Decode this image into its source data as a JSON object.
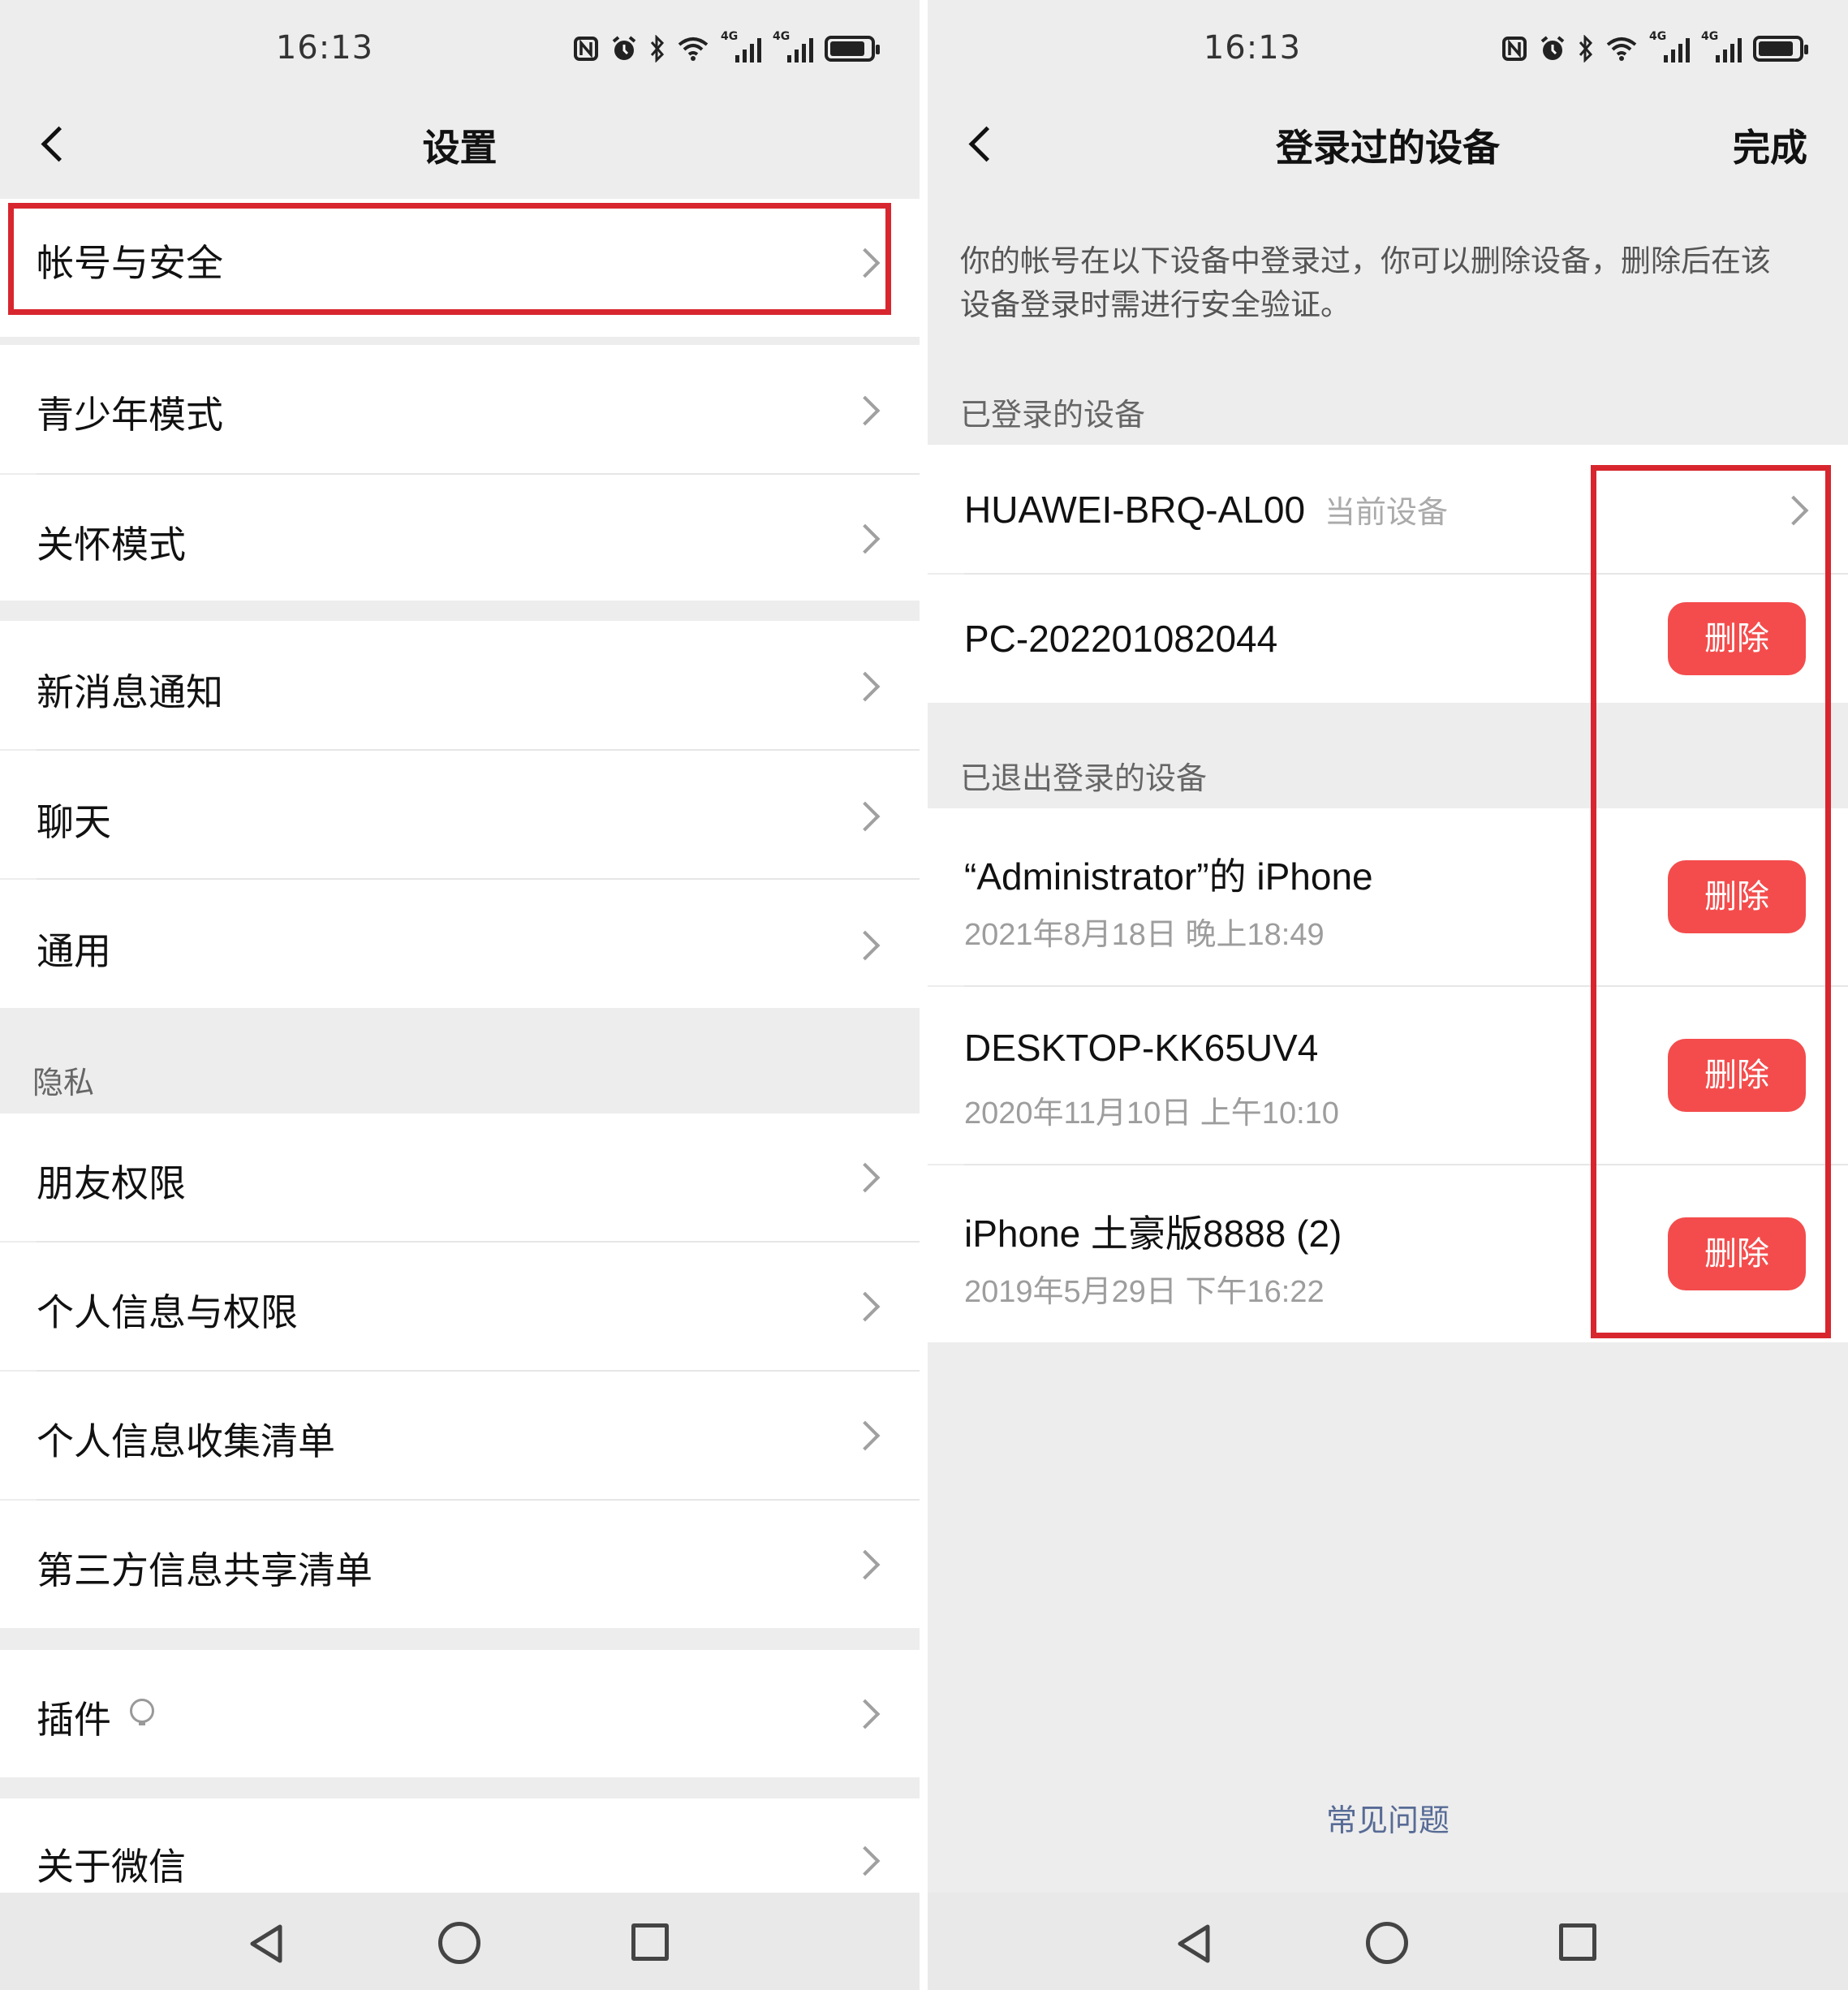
{
  "left_screen": {
    "status": {
      "time": "16:13",
      "net_label": "4G"
    },
    "title": "设置",
    "groups": {
      "account": [
        "帐号与安全"
      ],
      "modes": [
        "青少年模式",
        "关怀模式"
      ],
      "general": [
        "新消息通知",
        "聊天",
        "通用"
      ],
      "privacy_header": "隐私",
      "privacy": [
        "朋友权限",
        "个人信息与权限",
        "个人信息收集清单",
        "第三方信息共享清单"
      ],
      "plugins": [
        "插件"
      ],
      "about": [
        "关于微信"
      ]
    }
  },
  "right_screen": {
    "status": {
      "time": "16:13",
      "net_label": "4G"
    },
    "title": "登录过的设备",
    "done_label": "完成",
    "description": "你的帐号在以下设备中登录过，你可以删除设备，删除后在该设备登录时需进行安全验证。",
    "logged_in_header": "已登录的设备",
    "current_device": {
      "name": "HUAWEI-BRQ-AL00",
      "tag": "当前设备"
    },
    "logged_in_devices": [
      {
        "name": "PC-202201082044"
      }
    ],
    "logged_out_header": "已退出登录的设备",
    "logged_out_devices": [
      {
        "name": "“Administrator”的 iPhone",
        "time": "2021年8月18日 晚上18:49"
      },
      {
        "name": "DESKTOP-KK65UV4",
        "time": "2020年11月10日 上午10:10"
      },
      {
        "name": "iPhone 土豪版8888 (2)",
        "time": "2019年5月29日 下午16:22"
      }
    ],
    "delete_label": "删除",
    "faq_label": "常见问题"
  },
  "colors": {
    "highlight": "#d8262f",
    "delete_button": "#f44c4c",
    "link": "#576b95",
    "background": "#ededed"
  },
  "icons": [
    "back-icon",
    "chevron-right-icon",
    "nfc-icon",
    "alarm-icon",
    "bluetooth-icon",
    "wifi-icon",
    "signal-icon",
    "battery-icon",
    "plugin-bulb-icon",
    "nav-back-icon",
    "nav-home-icon",
    "nav-recent-icon"
  ]
}
